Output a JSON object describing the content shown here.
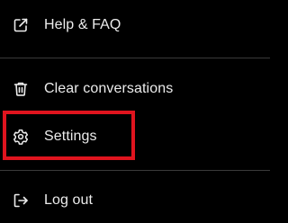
{
  "menu": {
    "items": [
      {
        "label": "Help & FAQ",
        "icon": "external-link-icon"
      },
      {
        "label": "Clear conversations",
        "icon": "trash-icon"
      },
      {
        "label": "Settings",
        "icon": "gear-icon"
      },
      {
        "label": "Log out",
        "icon": "logout-icon"
      }
    ]
  },
  "colors": {
    "background": "#000000",
    "text": "#ececec",
    "divider": "#3a3a3a",
    "highlight": "#e0141e"
  }
}
